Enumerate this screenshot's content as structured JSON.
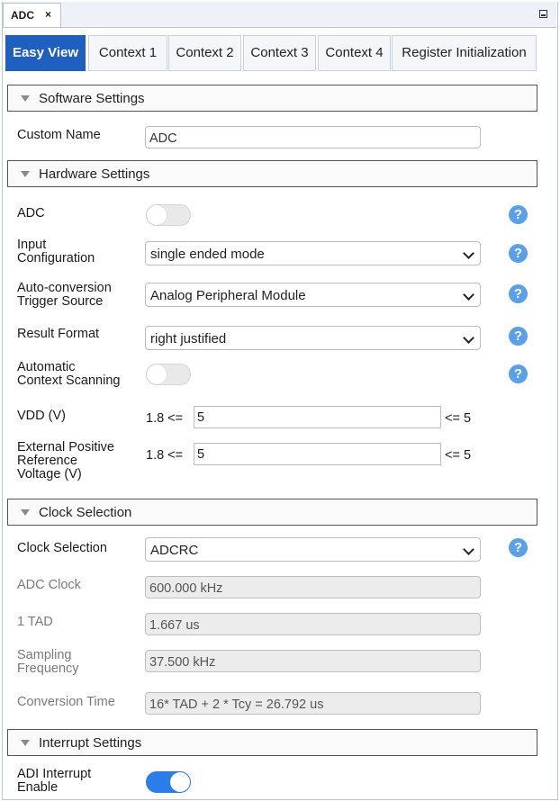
{
  "window": {
    "tab_label": "ADC",
    "close_glyph": "×"
  },
  "view_tabs": [
    "Easy View",
    "Context 1",
    "Context 2",
    "Context 3",
    "Context 4",
    "Register Initialization"
  ],
  "sections": {
    "software": "Software Settings",
    "hardware": "Hardware Settings",
    "clock": "Clock Selection",
    "interrupt": "Interrupt Settings"
  },
  "software": {
    "custom_name_label": "Custom Name",
    "custom_name_value": "ADC"
  },
  "hardware": {
    "adc_label": "ADC",
    "adc_enabled": false,
    "input_config_label_1": "Input",
    "input_config_label_2": "Configuration",
    "input_config_value": "single ended mode",
    "trigger_label_1": "Auto-conversion",
    "trigger_label_2": "Trigger Source",
    "trigger_value": "Analog Peripheral Module",
    "result_format_label": "Result Format",
    "result_format_value": "right justified",
    "scan_label_1": "Automatic",
    "scan_label_2": "Context Scanning",
    "scan_enabled": false,
    "vdd_label": "VDD (V)",
    "vdd_min": "1.8 <=",
    "vdd_value": "5",
    "vdd_max": "<= 5",
    "vref_label_1": "External Positive",
    "vref_label_2": "Reference",
    "vref_label_3": "Voltage (V)",
    "vref_min": "1.8 <=",
    "vref_value": "5",
    "vref_max": "<= 5"
  },
  "clock": {
    "selection_label": "Clock Selection",
    "selection_value": "ADCRC",
    "adc_clock_label": "ADC Clock",
    "adc_clock_value": "600.000 kHz",
    "tad_label": "1 TAD",
    "tad_value": "1.667 us",
    "sampling_label_1": "Sampling",
    "sampling_label_2": "Frequency",
    "sampling_value": "37.500 kHz",
    "conversion_label": "Conversion Time",
    "conversion_value": "16* TAD + 2 * Tcy = 26.792 us"
  },
  "interrupt": {
    "adi_label_1": "ADI Interrupt",
    "adi_label_2": "Enable",
    "adi_enabled": true
  },
  "help_glyph": "?",
  "colors": {
    "accent": "#1f5fbf",
    "toggle_on": "#2b7de9",
    "help": "#5aa0e8"
  }
}
